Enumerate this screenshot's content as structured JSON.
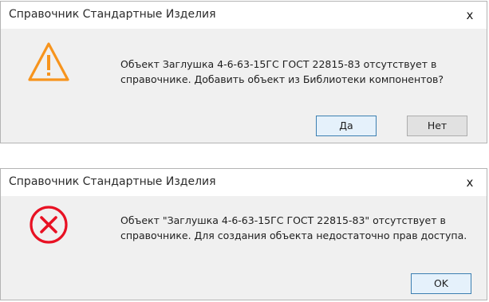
{
  "dialogs": [
    {
      "title": "Справочник Стандартные Изделия",
      "close_glyph": "x",
      "icon": "warning-icon",
      "message_lines": [
        "Объект Заглушка 4-6-63-15ГС ГОСТ 22815-83 отсутствует в",
        "справочнике. Добавить объект из Библиотеки компонентов?"
      ],
      "buttons": {
        "yes": "Да",
        "no": "Нет"
      }
    },
    {
      "title": "Справочник Стандартные Изделия",
      "close_glyph": "x",
      "icon": "error-icon",
      "message_lines": [
        "Объект \"Заглушка 4-6-63-15ГС ГОСТ 22815-83\" отсутствует в",
        "справочнике. Для создания объекта недостаточно прав доступа."
      ],
      "buttons": {
        "ok": "OK"
      }
    }
  ],
  "colors": {
    "warning": "#f7941d",
    "error": "#e81123",
    "default_button_border": "#3c7fb1"
  }
}
